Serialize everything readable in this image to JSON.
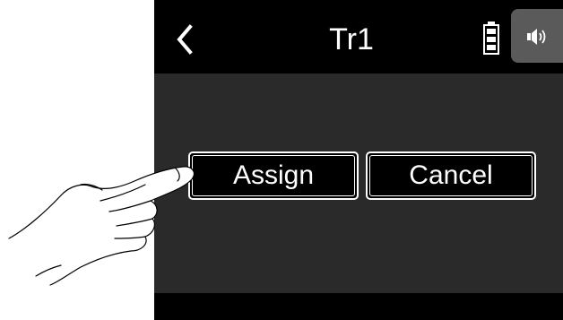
{
  "header": {
    "back_icon": "chevron-left-icon",
    "title": "Tr1",
    "battery_icon": "battery-icon",
    "speaker_icon": "speaker-icon"
  },
  "dialog": {
    "assign_label": "Assign",
    "cancel_label": "Cancel"
  },
  "colors": {
    "screen_bg": "#2a2a2a",
    "bar_bg": "#000000",
    "text": "#ffffff",
    "speaker_bg": "#5a5a5a"
  }
}
